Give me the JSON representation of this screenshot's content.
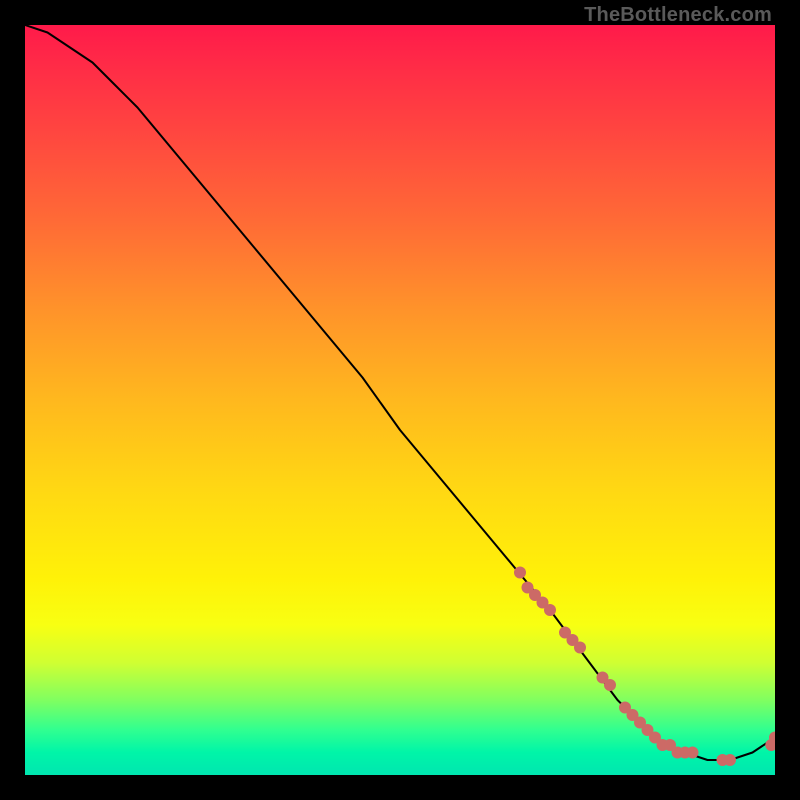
{
  "watermark": "TheBottleneck.com",
  "chart_data": {
    "type": "line",
    "title": "",
    "xlabel": "",
    "ylabel": "",
    "xlim": [
      0,
      100
    ],
    "ylim": [
      0,
      100
    ],
    "grid": false,
    "legend": false,
    "series": [
      {
        "name": "curve",
        "x": [
          0,
          3,
          6,
          9,
          12,
          15,
          20,
          25,
          30,
          35,
          40,
          45,
          50,
          55,
          60,
          65,
          70,
          73,
          76,
          79,
          82,
          85,
          88,
          91,
          94,
          97,
          100
        ],
        "y": [
          100,
          99,
          97,
          95,
          92,
          89,
          83,
          77,
          71,
          65,
          59,
          53,
          46,
          40,
          34,
          28,
          22,
          18,
          14,
          10,
          7,
          4,
          3,
          2,
          2,
          3,
          5
        ],
        "color": "#000000"
      },
      {
        "name": "markers",
        "x": [
          66,
          67,
          68,
          69,
          70,
          72,
          73,
          74,
          77,
          78,
          80,
          81,
          82,
          83,
          84,
          85,
          86,
          87,
          88,
          89,
          93,
          94,
          99.5,
          100
        ],
        "y": [
          27,
          25,
          24,
          23,
          22,
          19,
          18,
          17,
          13,
          12,
          9,
          8,
          7,
          6,
          5,
          4,
          4,
          3,
          3,
          3,
          2,
          2,
          4,
          5
        ],
        "color": "#cc6a66"
      }
    ],
    "gradient_stops": [
      {
        "pos": 0.0,
        "color": "#ff1a4a"
      },
      {
        "pos": 0.5,
        "color": "#ffd813"
      },
      {
        "pos": 0.8,
        "color": "#f8ff12"
      },
      {
        "pos": 1.0,
        "color": "#00e6b0"
      }
    ]
  }
}
